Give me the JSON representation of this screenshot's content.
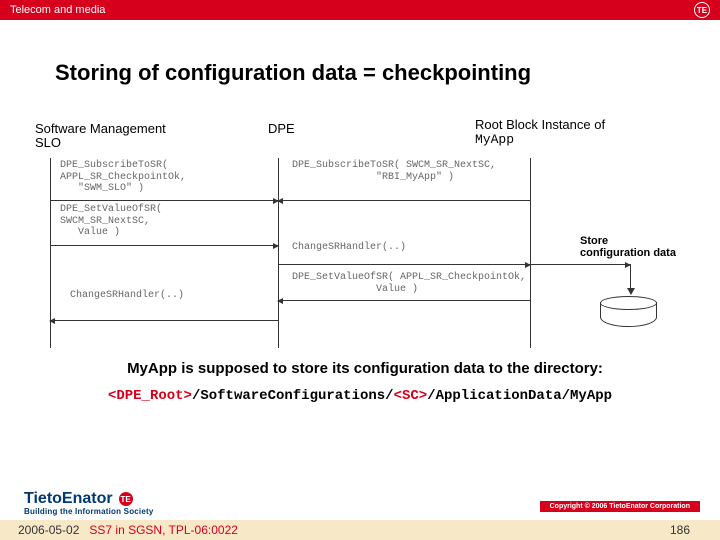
{
  "topbar": {
    "category": "Telecom and media",
    "badge": "TE"
  },
  "title": "Storing of configuration data = checkpointing",
  "lifelines": {
    "slo": "Software Management SLO",
    "dpe": "DPE",
    "rbi_prefix": "Root Block Instance of",
    "rbi_app": "MyApp"
  },
  "messages": {
    "m1": "DPE_SubscribeToSR(\nAPPL_SR_CheckpointOk,\n   \"SWM_SLO\" )",
    "m2": "DPE_SubscribeToSR( SWCM_SR_NextSC,\n              \"RBI_MyApp\" )",
    "m3": "DPE_SetValueOfSR(\nSWCM_SR_NextSC,\n   Value )",
    "m4": "ChangeSRHandler(..)",
    "m5": "DPE_SetValueOfSR( APPL_SR_CheckpointOk,\n              Value )",
    "m6": "ChangeSRHandler(..)"
  },
  "store_label": "Store configuration data",
  "caption": "MyApp is supposed to store its configuration data to the directory:",
  "path": {
    "p1": "<DPE_Root>",
    "p2": "/SoftwareConfigurations/",
    "p3": "<SC>",
    "p4": "/ApplicationData/MyApp"
  },
  "logo": {
    "brand": "TietoEnator",
    "tag": "Building the Information Society",
    "badge": "TE"
  },
  "copyright": "Copyright © 2006 TietoEnator Corporation",
  "footer": {
    "date": "2006-05-02",
    "mid": "SS7 in SGSN, TPL-06:0022",
    "page": "186"
  }
}
